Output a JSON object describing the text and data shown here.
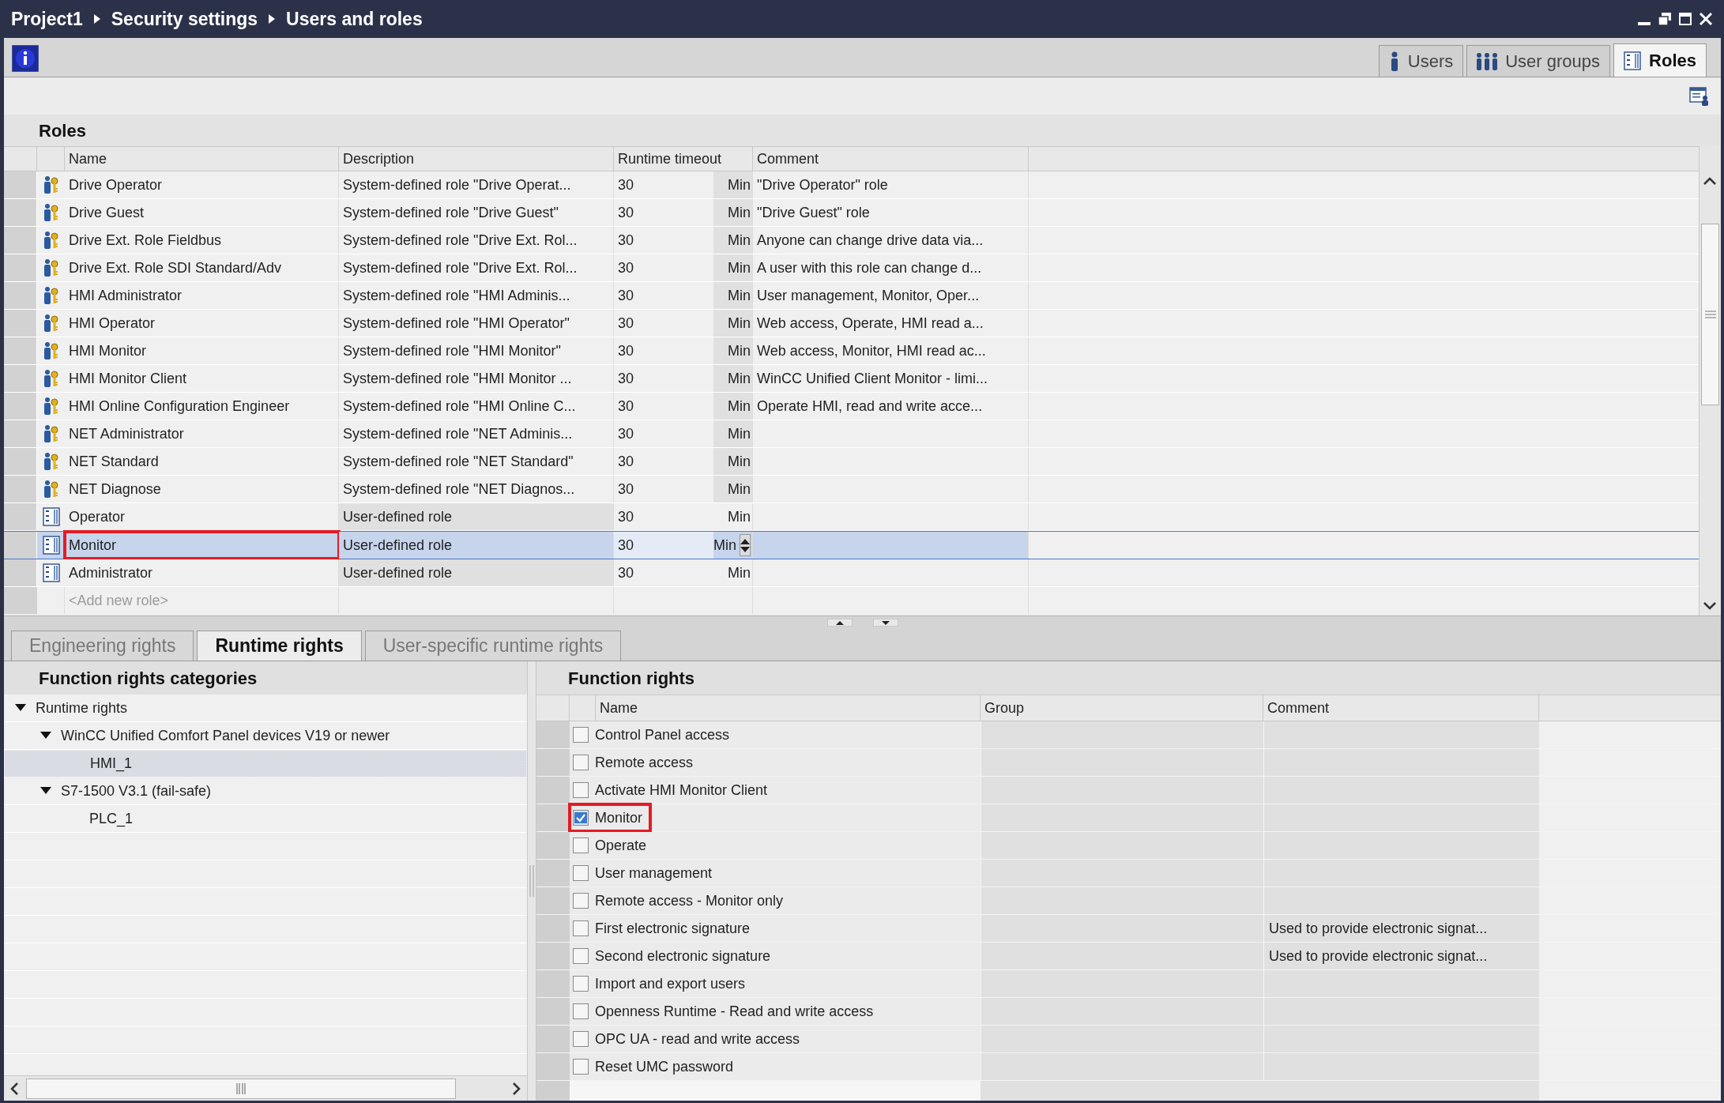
{
  "window": {
    "breadcrumb": [
      "Project1",
      "Security settings",
      "Users and roles"
    ]
  },
  "tabs": [
    {
      "label": "Users",
      "selected": false,
      "kind": "user"
    },
    {
      "label": "User groups",
      "selected": false,
      "kind": "group"
    },
    {
      "label": "Roles",
      "selected": true,
      "kind": "role"
    }
  ],
  "roles": {
    "title": "Roles",
    "columns": [
      "Name",
      "Description",
      "Runtime timeout",
      "Comment"
    ],
    "rows": [
      {
        "kind": "system",
        "name": "Drive Operator",
        "description": "System-defined role \"Drive Operat...",
        "timeout": "30",
        "unit": "Min",
        "comment": "\"Drive Operator\" role",
        "selected": false,
        "highlighted": false
      },
      {
        "kind": "system",
        "name": "Drive Guest",
        "description": "System-defined role \"Drive Guest\"",
        "timeout": "30",
        "unit": "Min",
        "comment": "\"Drive Guest\" role",
        "selected": false,
        "highlighted": false
      },
      {
        "kind": "system",
        "name": "Drive Ext. Role Fieldbus",
        "description": "System-defined role \"Drive Ext. Rol...",
        "timeout": "30",
        "unit": "Min",
        "comment": "Anyone can change drive data via...",
        "selected": false,
        "highlighted": false
      },
      {
        "kind": "system",
        "name": "Drive Ext. Role SDI Standard/Adv",
        "description": "System-defined role \"Drive Ext. Rol...",
        "timeout": "30",
        "unit": "Min",
        "comment": "A user with this role can change d...",
        "selected": false,
        "highlighted": false
      },
      {
        "kind": "system",
        "name": "HMI Administrator",
        "description": "System-defined role \"HMI Adminis...",
        "timeout": "30",
        "unit": "Min",
        "comment": "User management, Monitor, Oper...",
        "selected": false,
        "highlighted": false
      },
      {
        "kind": "system",
        "name": "HMI Operator",
        "description": "System-defined role \"HMI Operator\"",
        "timeout": "30",
        "unit": "Min",
        "comment": "Web access, Operate, HMI read a...",
        "selected": false,
        "highlighted": false
      },
      {
        "kind": "system",
        "name": "HMI Monitor",
        "description": "System-defined role \"HMI Monitor\"",
        "timeout": "30",
        "unit": "Min",
        "comment": "Web access, Monitor, HMI read ac...",
        "selected": false,
        "highlighted": false
      },
      {
        "kind": "system",
        "name": "HMI Monitor Client",
        "description": "System-defined role \"HMI Monitor ...",
        "timeout": "30",
        "unit": "Min",
        "comment": "WinCC Unified Client Monitor - limi...",
        "selected": false,
        "highlighted": false
      },
      {
        "kind": "system",
        "name": "HMI Online Configuration Engineer",
        "description": "System-defined role \"HMI Online C...",
        "timeout": "30",
        "unit": "Min",
        "comment": "Operate HMI, read and write acce...",
        "selected": false,
        "highlighted": false
      },
      {
        "kind": "system",
        "name": "NET Administrator",
        "description": "System-defined role \"NET Adminis...",
        "timeout": "30",
        "unit": "Min",
        "selected": false,
        "highlighted": false
      },
      {
        "kind": "system",
        "name": "NET Standard",
        "description": "System-defined role \"NET Standard\"",
        "timeout": "30",
        "unit": "Min",
        "selected": false,
        "highlighted": false
      },
      {
        "kind": "system",
        "name": "NET Diagnose",
        "description": "System-defined role \"NET Diagnos...",
        "timeout": "30",
        "unit": "Min",
        "selected": false,
        "highlighted": false
      },
      {
        "kind": "user",
        "name": "Operator",
        "description": "User-defined role",
        "timeout": "30",
        "unit": "Min",
        "selected": false,
        "highlighted": false
      },
      {
        "kind": "user",
        "name": "Monitor",
        "description": "User-defined role",
        "timeout": "30",
        "unit": "Min",
        "selected": true,
        "highlighted": true
      },
      {
        "kind": "user",
        "name": "Administrator",
        "description": "User-defined role",
        "timeout": "30",
        "unit": "Min",
        "selected": false,
        "highlighted": false
      }
    ],
    "add_row": {
      "placeholder": "<Add new role>"
    }
  },
  "rights_tabs": [
    {
      "label": "Engineering rights",
      "selected": false
    },
    {
      "label": "Runtime rights",
      "selected": true
    },
    {
      "label": "User-specific runtime rights",
      "selected": false
    }
  ],
  "categories": {
    "title": "Function rights categories",
    "tree": [
      {
        "label": "Runtime rights",
        "expanded": true,
        "selected": false,
        "children": [
          {
            "label": "WinCC Unified Comfort Panel devices V19 or newer",
            "expanded": true,
            "selected": false,
            "children": [
              {
                "label": "HMI_1",
                "selected": true
              }
            ]
          },
          {
            "label": "S7-1500 V3.1 (fail-safe)",
            "expanded": true,
            "selected": false,
            "children": [
              {
                "label": "PLC_1",
                "selected": false
              }
            ]
          }
        ]
      }
    ]
  },
  "function_rights": {
    "title": "Function rights",
    "columns": [
      "Name",
      "Group",
      "Comment"
    ],
    "rows": [
      {
        "name": "Control Panel access",
        "checked": false,
        "highlighted": false
      },
      {
        "name": "Remote access",
        "checked": false,
        "highlighted": false
      },
      {
        "name": "Activate HMI Monitor Client",
        "checked": false,
        "highlighted": false
      },
      {
        "name": "Monitor",
        "checked": true,
        "highlighted": true
      },
      {
        "name": "Operate",
        "checked": false,
        "highlighted": false
      },
      {
        "name": "User management",
        "checked": false,
        "highlighted": false
      },
      {
        "name": "Remote access - Monitor only",
        "checked": false,
        "highlighted": false
      },
      {
        "name": "First electronic signature",
        "checked": false,
        "highlighted": false,
        "comment": "Used to provide electronic signat..."
      },
      {
        "name": "Second electronic signature",
        "checked": false,
        "highlighted": false,
        "comment": "Used to provide electronic signat..."
      },
      {
        "name": "Import and export users",
        "checked": false,
        "highlighted": false
      },
      {
        "name": "Openness Runtime - Read and write access",
        "checked": false,
        "highlighted": false
      },
      {
        "name": "OPC UA - read and write access",
        "checked": false,
        "highlighted": false
      },
      {
        "name": "Reset UMC password",
        "checked": false,
        "highlighted": false
      }
    ]
  }
}
